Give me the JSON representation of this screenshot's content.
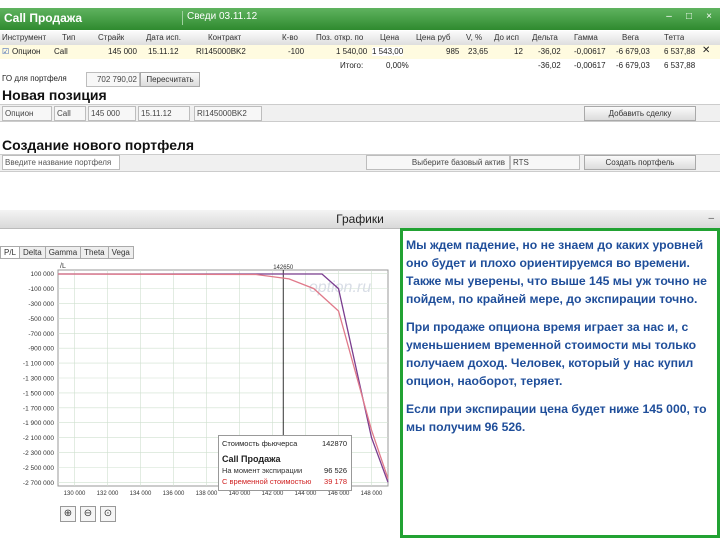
{
  "titlebar": {
    "title": "Call Продажа",
    "session": "Сведи 03.11.12",
    "controls": [
      "–",
      "□",
      "×"
    ]
  },
  "table": {
    "headers": [
      "Инструмент",
      "Тип",
      "Страйк",
      "Дата исп.",
      "Контракт",
      "К-во",
      "Поз. откр. по",
      "Цена",
      "Цена руб",
      "V, %",
      "До исп",
      "Дельта",
      "Гамма",
      "Вега",
      "Тетта"
    ],
    "row": [
      "Опцион",
      "Call",
      "145 000",
      "15.11.12",
      "RI145000BK2",
      "-100",
      "1 540,00",
      "1 543,00",
      "985",
      "23,65",
      "12",
      "-36,02",
      "-0,00617",
      "-6 679,03",
      "6 537,88"
    ],
    "total_label": "Итого:",
    "total_row": [
      "0,00%",
      "-36,02",
      "-0,00617",
      "-6 679,03",
      "6 537,88"
    ]
  },
  "go_label": "ГО для портфеля",
  "go_value": "702 790,02",
  "recalc_button": "Пересчитать",
  "new_position": {
    "title": "Новая позиция",
    "fields": [
      "Опцион",
      "Call",
      "145 000",
      "15.11.12",
      "RI145000BK2"
    ],
    "add_button": "Добавить сделку"
  },
  "new_portfolio": {
    "title": "Создание нового портфеля",
    "name_placeholder": "Введите название портфеля",
    "asset_label": "Выберите базовый актив",
    "asset_value": "RTS",
    "create_button": "Создать портфель"
  },
  "graphs": {
    "title": "Графики",
    "minimize": "–",
    "tabs": [
      "P/L",
      "Delta",
      "Gamma",
      "Theta",
      "Vega"
    ],
    "active_tab": "P/L"
  },
  "tooltip": {
    "futures_label": "Стоимость фьючерса",
    "futures_value": "142870",
    "series_title": "Call Продажа",
    "expiry_label": "На момент экспирации",
    "expiry_value": "96 526",
    "time_label": "С временной стоимостью",
    "time_value": "39 178"
  },
  "watermark": "option.ru",
  "zoom_icons": [
    "zoom-in-icon",
    "zoom-out-icon",
    "zoom-reset-icon"
  ],
  "note": {
    "p1": "Мы ждем падение, но не знаем до каких уровней оно будет и плохо ориентируемся во времени. Также мы уверены, что выше 145 мы уж точно не пойдем, по крайней мере, до экспирации точно.",
    "p2": "При продаже опциона время играет за нас и, с уменьшением временной стоимости мы только получаем доход. Человек, который у нас купил опцион, наоборот, теряет.",
    "p3": "Если при экспирации цена будет ниже 145 000, то мы получим 96 526."
  },
  "colors": {
    "title_green": "#2f8a2f",
    "note_blue": "#1f4e9a",
    "frame_green": "#22a233",
    "expiry_line": "#7a3d8f",
    "time_line": "#e07a8a"
  },
  "chart_data": {
    "type": "line",
    "x_ticks": [
      "130 000",
      "132 000",
      "134 000",
      "136 000",
      "138 000",
      "140 000",
      "142 000",
      "144 000",
      "146 000",
      "148 000"
    ],
    "y_ticks": [
      "100 000",
      "-100 000",
      "-300 000",
      "-500 000",
      "-700 000",
      "-900 000",
      "-1 100 000",
      "-1 300 000",
      "-1 500 000",
      "-1 700 000",
      "-1 900 000",
      "-2 100 000",
      "-2 300 000",
      "-2 500 000",
      "-2 700 000"
    ],
    "marker_label": "142650",
    "y_axis_label": "/L",
    "xlim": [
      129000,
      149000
    ],
    "ylim": [
      -2750000,
      150000
    ],
    "series": [
      {
        "name": "На момент экспирации",
        "points": [
          [
            129000,
            96526
          ],
          [
            145000,
            96526
          ],
          [
            146000,
            -100000
          ],
          [
            148000,
            -2100000
          ],
          [
            149000,
            -2700000
          ]
        ]
      },
      {
        "name": "С временной стоимостью",
        "points": [
          [
            129000,
            96000
          ],
          [
            141000,
            90000
          ],
          [
            143000,
            30000
          ],
          [
            144500,
            -100000
          ],
          [
            146000,
            -400000
          ],
          [
            148000,
            -2000000
          ],
          [
            149000,
            -2650000
          ]
        ]
      }
    ]
  }
}
